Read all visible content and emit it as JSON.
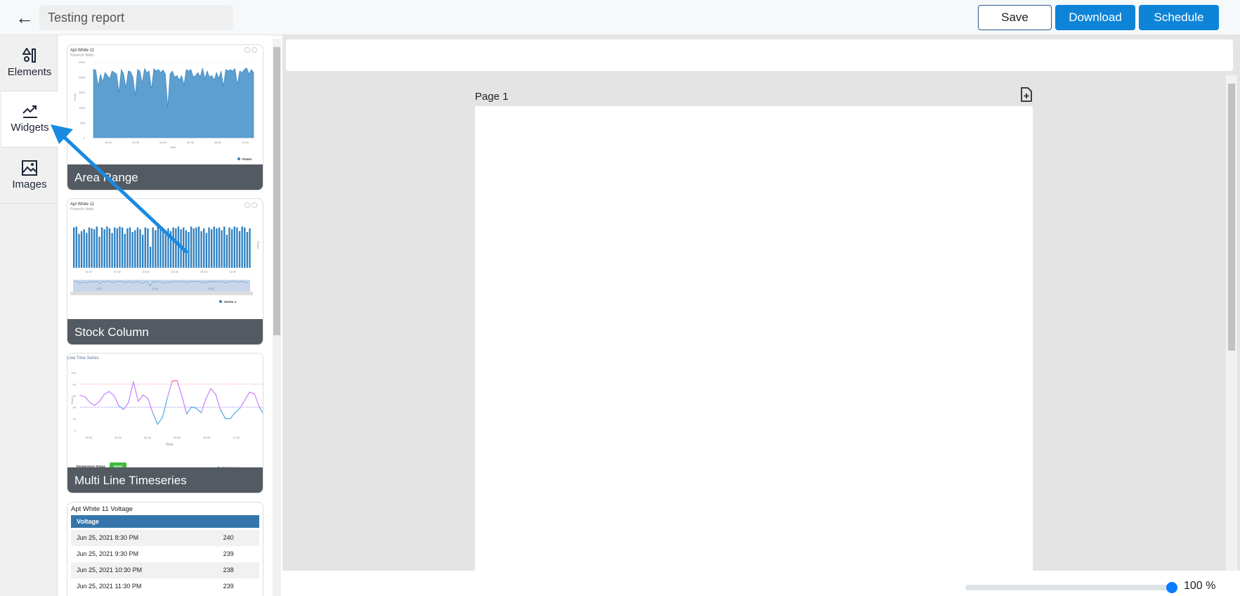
{
  "header": {
    "title_value": "Testing report",
    "save_label": "Save",
    "download_label": "Download",
    "schedule_label": "Schedule"
  },
  "tabs": [
    {
      "label": "Elements",
      "icon": "shapes-icon"
    },
    {
      "label": "Widgets",
      "icon": "trend-icon",
      "active": true
    },
    {
      "label": "Images",
      "icon": "image-icon"
    }
  ],
  "widgets": [
    {
      "label": "Area Range",
      "chart": {
        "type": "area",
        "title": "Apt White 11",
        "subtitle": "Power(In Watt)",
        "ylabel": "Power",
        "xlabel": "Date",
        "yticks": [
          "2500",
          "2000",
          "1500",
          "1000",
          "500",
          "0"
        ],
        "xticks": [
          "16:30",
          "20:30",
          "00:30",
          "04:30",
          "08:30",
          "12:30"
        ],
        "legend": "Power",
        "ylim": [
          0,
          2500
        ],
        "values": [
          2250,
          2230,
          1700,
          2100,
          1850,
          2150,
          2050,
          1950,
          2200,
          2150,
          2100,
          1500,
          2250,
          2100,
          1650,
          2200,
          2180,
          2000,
          1400,
          2250,
          2200,
          1800,
          2280,
          2150,
          2200,
          1600,
          2280,
          2200,
          2250,
          2150,
          2230,
          2100,
          1000,
          2100,
          2200,
          2000,
          2050,
          1900,
          2050,
          1750,
          2250,
          2200,
          2250,
          2000,
          2050,
          2150,
          2000,
          2300,
          1950,
          2200,
          2000,
          2050,
          1900,
          2150,
          1950,
          2200,
          1700,
          2250,
          2200,
          2250,
          2200,
          2280,
          1750,
          2200,
          2150,
          2250,
          2300,
          2100,
          2250,
          2150
        ]
      }
    },
    {
      "label": "Stock Column",
      "chart": {
        "type": "column",
        "title": "Apt White 11",
        "subtitle": "Power(In Watt)",
        "ylabel": "Power",
        "xticks": [
          "16:30",
          "20:30",
          "00:30",
          "04:30",
          "08:30",
          "12:30"
        ],
        "navigator_ticks": [
          "16:30",
          "00:30",
          "08:30"
        ],
        "legend": "Series 1",
        "values": [
          2200,
          2250,
          1850,
          2000,
          2100,
          1900,
          2200,
          2150,
          2100,
          2250,
          1700,
          2200,
          2100,
          2250,
          2150,
          1900,
          2200,
          2150,
          2250,
          2200,
          1850,
          2150,
          2200,
          1950,
          2050,
          2200,
          2100,
          1800,
          2200,
          2150,
          1150,
          2200,
          2050,
          2250,
          2100,
          2000,
          1800,
          2150,
          2000,
          2200,
          2150,
          2250,
          2100,
          2200,
          2050,
          1950,
          2250,
          2150,
          2200,
          2250,
          2000,
          2150,
          1900,
          2200,
          2100,
          2250,
          2150,
          2200,
          2050,
          2250,
          1800,
          2200,
          2100,
          2250,
          2200,
          2000,
          2250,
          2200,
          1950,
          2150
        ]
      }
    },
    {
      "label": "Multi Line Timeseries",
      "chart": {
        "type": "line",
        "title": "Line Time Series",
        "ylabel": "Power",
        "xlabel": "Time",
        "yticks": [
          "100",
          "80",
          "60",
          "40",
          "20",
          "0"
        ],
        "xticks": [
          "16:30",
          "20:30",
          "00:30",
          "04:30",
          "08:30",
          "12:30"
        ],
        "ylim": [
          0,
          100
        ],
        "thresholds": {
          "high": 80,
          "low": 40
        },
        "colors": {
          "high": "#ff4d6d",
          "mid": "#c77dff",
          "low": "#4ea8de"
        },
        "values": [
          60,
          58,
          48,
          43,
          50,
          62,
          67,
          60,
          42,
          36,
          48,
          84,
          50,
          61,
          55,
          30,
          10,
          22,
          55,
          85,
          86,
          60,
          28,
          40,
          38,
          30,
          55,
          72,
          62,
          35,
          20,
          20,
          30,
          38,
          52,
          66,
          63,
          40,
          26
        ],
        "status_label": "Temperature Status",
        "status_value": "Good",
        "legend": "Data Point 1"
      }
    },
    {
      "label": "Apt White 11 Voltage",
      "table": {
        "header": "Voltage",
        "rows": [
          [
            "Jun 25, 2021 8:30 PM",
            "240"
          ],
          [
            "Jun 25, 2021 9:30 PM",
            "239"
          ],
          [
            "Jun 25, 2021 10:30 PM",
            "238"
          ],
          [
            "Jun 25, 2021 11:30 PM",
            "239"
          ]
        ]
      }
    }
  ],
  "canvas": {
    "page_label": "Page 1",
    "zoom_value": "100 %",
    "zoom_percent": 100
  },
  "colors": {
    "accent": "#0e84d8",
    "card_label_bg": "#535a62",
    "chart_blue": "#2f80c0",
    "table_header": "#3476ab"
  }
}
